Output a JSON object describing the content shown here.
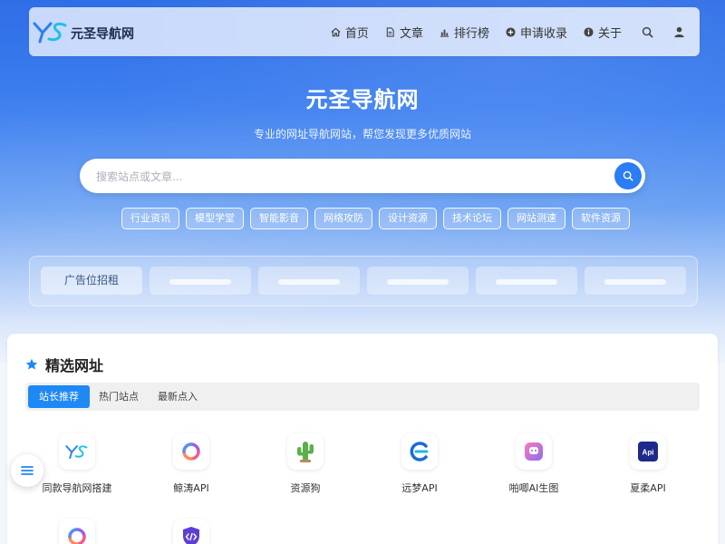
{
  "header": {
    "brand": "元圣导航网",
    "nav": [
      {
        "label": "首页",
        "icon": "home-icon"
      },
      {
        "label": "文章",
        "icon": "document-icon"
      },
      {
        "label": "排行榜",
        "icon": "ranking-icon"
      },
      {
        "label": "申请收录",
        "icon": "plus-circle-icon"
      },
      {
        "label": "关于",
        "icon": "info-circle-icon"
      }
    ]
  },
  "hero": {
    "title": "元圣导航网",
    "subtitle": "专业的网址导航网站，帮您发现更多优质网站",
    "search_placeholder": "搜索站点或文章...",
    "tags": [
      "行业资讯",
      "模型学堂",
      "智能影音",
      "网络攻防",
      "设计资源",
      "技术论坛",
      "网站测速",
      "软件资源"
    ]
  },
  "ads": {
    "label": "广告位招租"
  },
  "featured": {
    "title": "精选网址",
    "tabs": [
      "站长推荐",
      "热门站点",
      "最新点入"
    ],
    "active_tab": 0,
    "sites": [
      {
        "name": "同款导航网搭建",
        "icon": "ys-logo-icon"
      },
      {
        "name": "鲸涛API",
        "icon": "swirl-logo-icon"
      },
      {
        "name": "资源狗",
        "icon": "cactus-icon"
      },
      {
        "name": "远梦API",
        "icon": "c-logo-icon"
      },
      {
        "name": "啪唧AI生图",
        "icon": "chat-bubble-logo-icon"
      },
      {
        "name": "夏柔API",
        "icon": "api-logo-icon"
      },
      {
        "name": "",
        "icon": "swirl-logo-icon"
      },
      {
        "name": "",
        "icon": "code-shield-icon"
      }
    ]
  },
  "colors": {
    "accent": "#1e88f5",
    "hero_top": "#2f6ee6"
  }
}
